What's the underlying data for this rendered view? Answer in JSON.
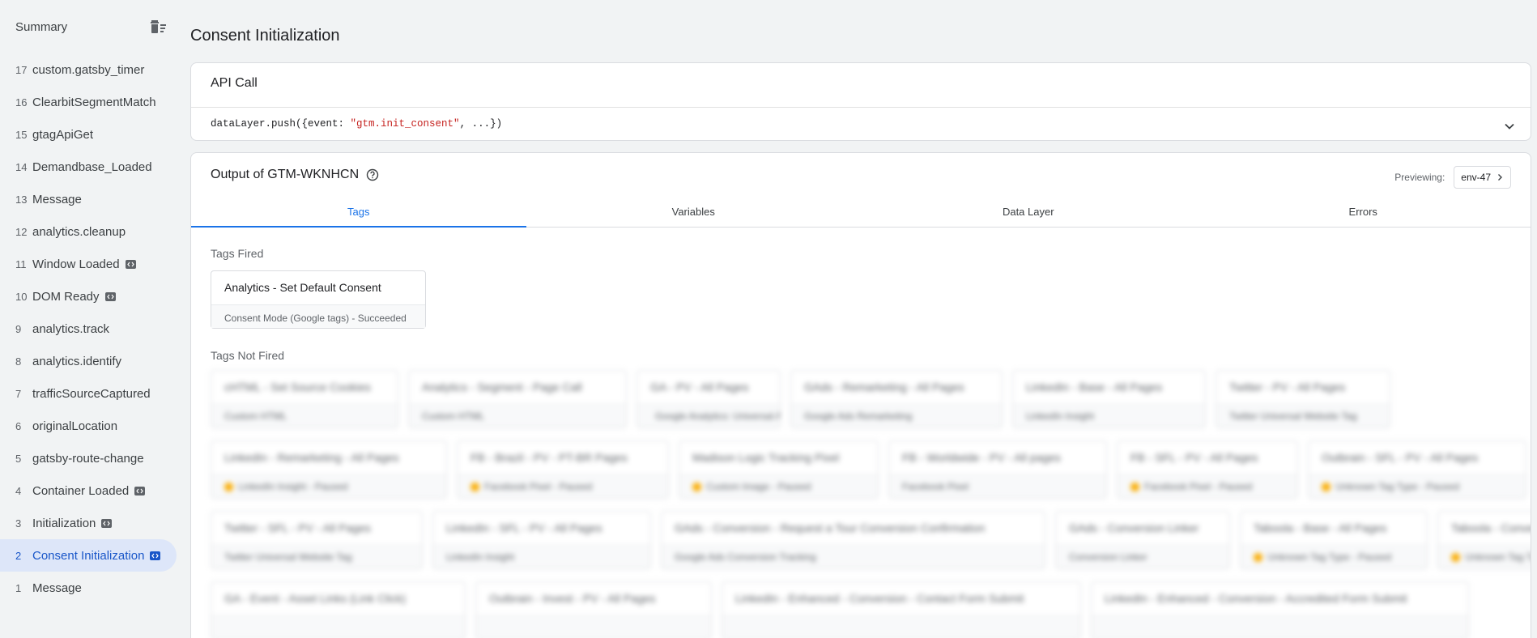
{
  "sidebar": {
    "title": "Summary",
    "events": [
      {
        "num": "17",
        "name": "custom.gatsby_timer",
        "badge": false,
        "selected": false
      },
      {
        "num": "16",
        "name": "ClearbitSegmentMatch",
        "badge": false,
        "selected": false
      },
      {
        "num": "15",
        "name": "gtagApiGet",
        "badge": false,
        "selected": false
      },
      {
        "num": "14",
        "name": "Demandbase_Loaded",
        "badge": false,
        "selected": false
      },
      {
        "num": "13",
        "name": "Message",
        "badge": false,
        "selected": false
      },
      {
        "num": "12",
        "name": "analytics.cleanup",
        "badge": false,
        "selected": false
      },
      {
        "num": "11",
        "name": "Window Loaded",
        "badge": true,
        "selected": false
      },
      {
        "num": "10",
        "name": "DOM Ready",
        "badge": true,
        "selected": false
      },
      {
        "num": "9",
        "name": "analytics.track",
        "badge": false,
        "selected": false
      },
      {
        "num": "8",
        "name": "analytics.identify",
        "badge": false,
        "selected": false
      },
      {
        "num": "7",
        "name": "trafficSourceCaptured",
        "badge": false,
        "selected": false
      },
      {
        "num": "6",
        "name": "originalLocation",
        "badge": false,
        "selected": false
      },
      {
        "num": "5",
        "name": "gatsby-route-change",
        "badge": false,
        "selected": false
      },
      {
        "num": "4",
        "name": "Container Loaded",
        "badge": true,
        "selected": false
      },
      {
        "num": "3",
        "name": "Initialization",
        "badge": true,
        "selected": false
      },
      {
        "num": "2",
        "name": "Consent Initialization",
        "badge": true,
        "selected": true
      },
      {
        "num": "1",
        "name": "Message",
        "badge": false,
        "selected": false
      }
    ]
  },
  "main": {
    "title": "Consent Initialization",
    "api_call": {
      "title": "API Call",
      "code_prefix": "dataLayer.push({event: ",
      "code_string": "\"gtm.init_consent\"",
      "code_suffix": ", ...})"
    },
    "output": {
      "title": "Output of GTM-WKNHCN",
      "previewing_label": "Previewing:",
      "env": "env-47",
      "tabs": [
        "Tags",
        "Variables",
        "Data Layer",
        "Errors"
      ],
      "active_tab": 0,
      "tags_fired_label": "Tags Fired",
      "tags_fired": [
        {
          "name": "Analytics - Set Default Consent",
          "status": "Consent Mode (Google tags) - Succeeded"
        }
      ],
      "tags_not_fired_label": "Tags Not Fired",
      "tags_not_fired_rows": [
        [
          {
            "name": "cHTML - Set Source Cookies",
            "status": "Custom HTML",
            "paused": false
          },
          {
            "name": "Analytics - Segment - Page Call",
            "status": "Custom HTML",
            "paused": false
          },
          {
            "name": "GA - PV - All Pages",
            "status": "Google Analytics: Universal Analytics - Paused",
            "paused": true
          },
          {
            "name": "GAds - Remarketing - All Pages",
            "status": "Google Ads Remarketing",
            "paused": false
          },
          {
            "name": "LinkedIn - Base - All Pages",
            "status": "LinkedIn Insight",
            "paused": false
          },
          {
            "name": "Twitter - PV - All Pages",
            "status": "Twitter Universal Website Tag",
            "paused": false
          }
        ],
        [
          {
            "name": "LinkedIn - Remarketing - All Pages",
            "status": "LinkedIn Insight - Paused",
            "paused": true
          },
          {
            "name": "FB - Brazil - PV - PT-BR Pages",
            "status": "Facebook Pixel - Paused",
            "paused": true
          },
          {
            "name": "Madison Logic Tracking Pixel",
            "status": "Custom Image - Paused",
            "paused": true
          },
          {
            "name": "FB - Worldwide - PV - All pages",
            "status": "Facebook Pixel",
            "paused": false
          },
          {
            "name": "FB - SFL - PV - All Pages",
            "status": "Facebook Pixel - Paused",
            "paused": true
          },
          {
            "name": "Outbrain - SFL - PV - All Pages",
            "status": "Unknown Tag Type - Paused",
            "paused": true
          }
        ],
        [
          {
            "name": "Twitter - SFL - PV - All Pages",
            "status": "Twitter Universal Website Tag",
            "paused": false
          },
          {
            "name": "LinkedIn - SFL - PV - All Pages",
            "status": "LinkedIn Insight",
            "paused": false
          },
          {
            "name": "GAds - Conversion - Request a Tour Conversion Confirmation",
            "status": "Google Ads Conversion Tracking",
            "paused": false
          },
          {
            "name": "GAds - Conversion Linker",
            "status": "Conversion Linker",
            "paused": false
          },
          {
            "name": "Taboola - Base - All Pages",
            "status": "Unknown Tag Type - Paused",
            "paused": true
          },
          {
            "name": "Taboola - Conversion - Tour",
            "status": "Unknown Tag Type - Paused",
            "paused": true
          }
        ],
        [
          {
            "name": "GA - Event - Asset Links (Link Click)",
            "status": "",
            "paused": false
          },
          {
            "name": "Outbrain - Invest - PV - All Pages",
            "status": "",
            "paused": false
          },
          {
            "name": "LinkedIn - Enhanced - Conversion - Contact Form Submit",
            "status": "",
            "paused": false
          },
          {
            "name": "LinkedIn - Enhanced - Conversion - Accredited Form Submit",
            "status": "",
            "paused": false
          }
        ]
      ]
    }
  }
}
